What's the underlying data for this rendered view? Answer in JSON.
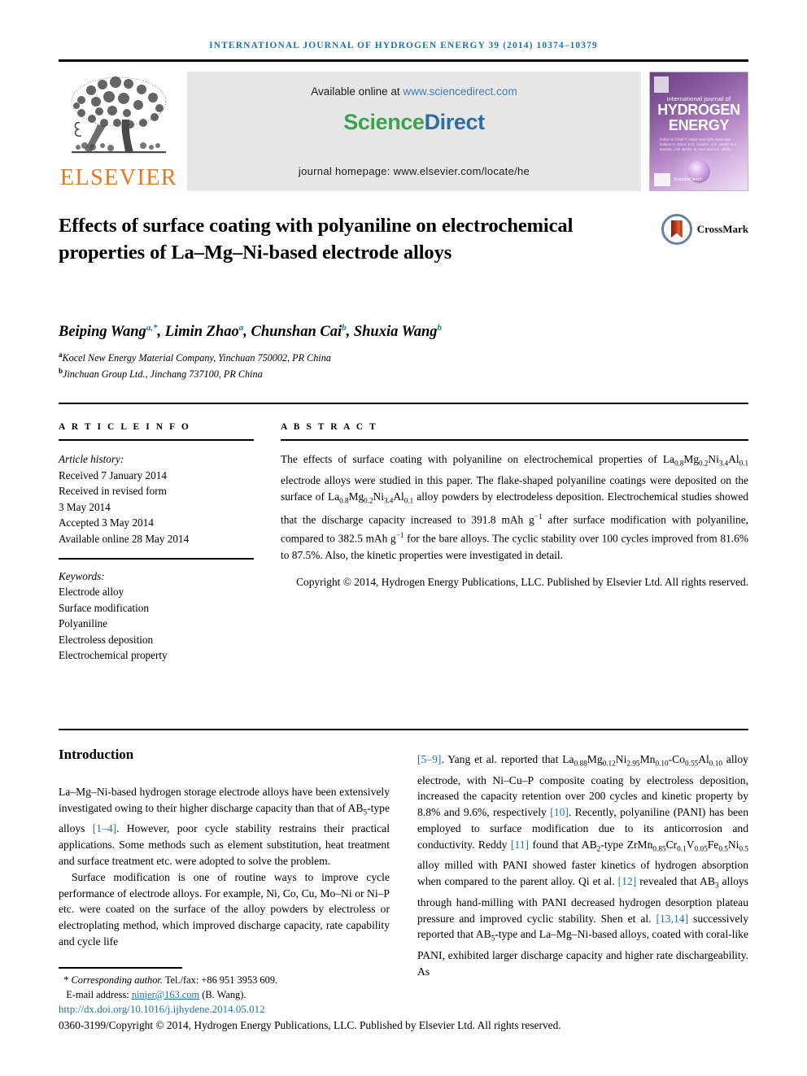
{
  "running_head": "International Journal of Hydrogen Energy 39 (2014) 10374–10379",
  "masthead": {
    "publisher_logo_text": "ELSEVIER",
    "available_prefix": "Available online at ",
    "available_url": "www.sciencedirect.com",
    "sciencedirect_science": "Science",
    "sciencedirect_direct": "Direct",
    "homepage": "journal homepage: www.elsevier.com/locate/he",
    "cover": {
      "line1": "international journal of",
      "line2": "HYDROGEN",
      "line3": "ENERGY",
      "editors": "Editor-in-Chief  T. Nejat Veziroğlu    Associate Editors  S. Dunn, E.D. Gordon, H.K. Abdel,  B.Z. Nandor, J.M. Berlin,  D. Hart and D.L. Stojic",
      "bottom_text": "ScienceDirect"
    }
  },
  "title": "Effects of surface coating with polyaniline on electrochemical properties of La–Mg–Ni-based electrode alloys",
  "crossmark_label": "CrossMark",
  "authors": [
    {
      "name": "Beiping Wang",
      "marks": "a,*"
    },
    {
      "name": "Limin Zhao",
      "marks": "a"
    },
    {
      "name": "Chunshan Cai",
      "marks": "b"
    },
    {
      "name": "Shuxia Wang",
      "marks": "b"
    }
  ],
  "affiliations": [
    {
      "mark": "a",
      "text": "Kocel New Energy Material Company, Yinchuan 750002, PR China"
    },
    {
      "mark": "b",
      "text": "Jinchuan Group Ltd., Jinchang 737100, PR China"
    }
  ],
  "article_info": {
    "heading": "A R T I C L E   I N F O",
    "history_label": "Article history:",
    "history": [
      "Received 7 January 2014",
      "Received in revised form",
      "3 May 2014",
      "Accepted 3 May 2014",
      "Available online 28 May 2014"
    ],
    "keywords_label": "Keywords:",
    "keywords": [
      "Electrode alloy",
      "Surface modification",
      "Polyaniline",
      "Electroless deposition",
      "Electrochemical property"
    ]
  },
  "abstract": {
    "heading": "A B S T R A C T",
    "copyright": "Copyright © 2014, Hydrogen Energy Publications, LLC. Published by Elsevier Ltd. All rights reserved."
  },
  "body": {
    "intro_heading": "Introduction",
    "copyright_footer": "0360-3199/Copyright © 2014, Hydrogen Energy Publications, LLC. Published by Elsevier Ltd. All rights reserved.",
    "corresponding_marker": "*",
    "corresponding_label": "Corresponding author.",
    "corresponding_tel": " Tel./fax: +86 951 3953 609.",
    "email_label": "E-mail address: ",
    "email": "ninjer@163.com",
    "email_suffix": " (B. Wang).",
    "doi": "http://dx.doi.org/10.1016/j.ijhydene.2014.05.012"
  },
  "colors": {
    "link_blue": "#1b75a8",
    "elsevier_orange": "#E87722",
    "sciencedirect_green": "#3aa44b",
    "sciencedirect_blue": "#2e6da4"
  }
}
